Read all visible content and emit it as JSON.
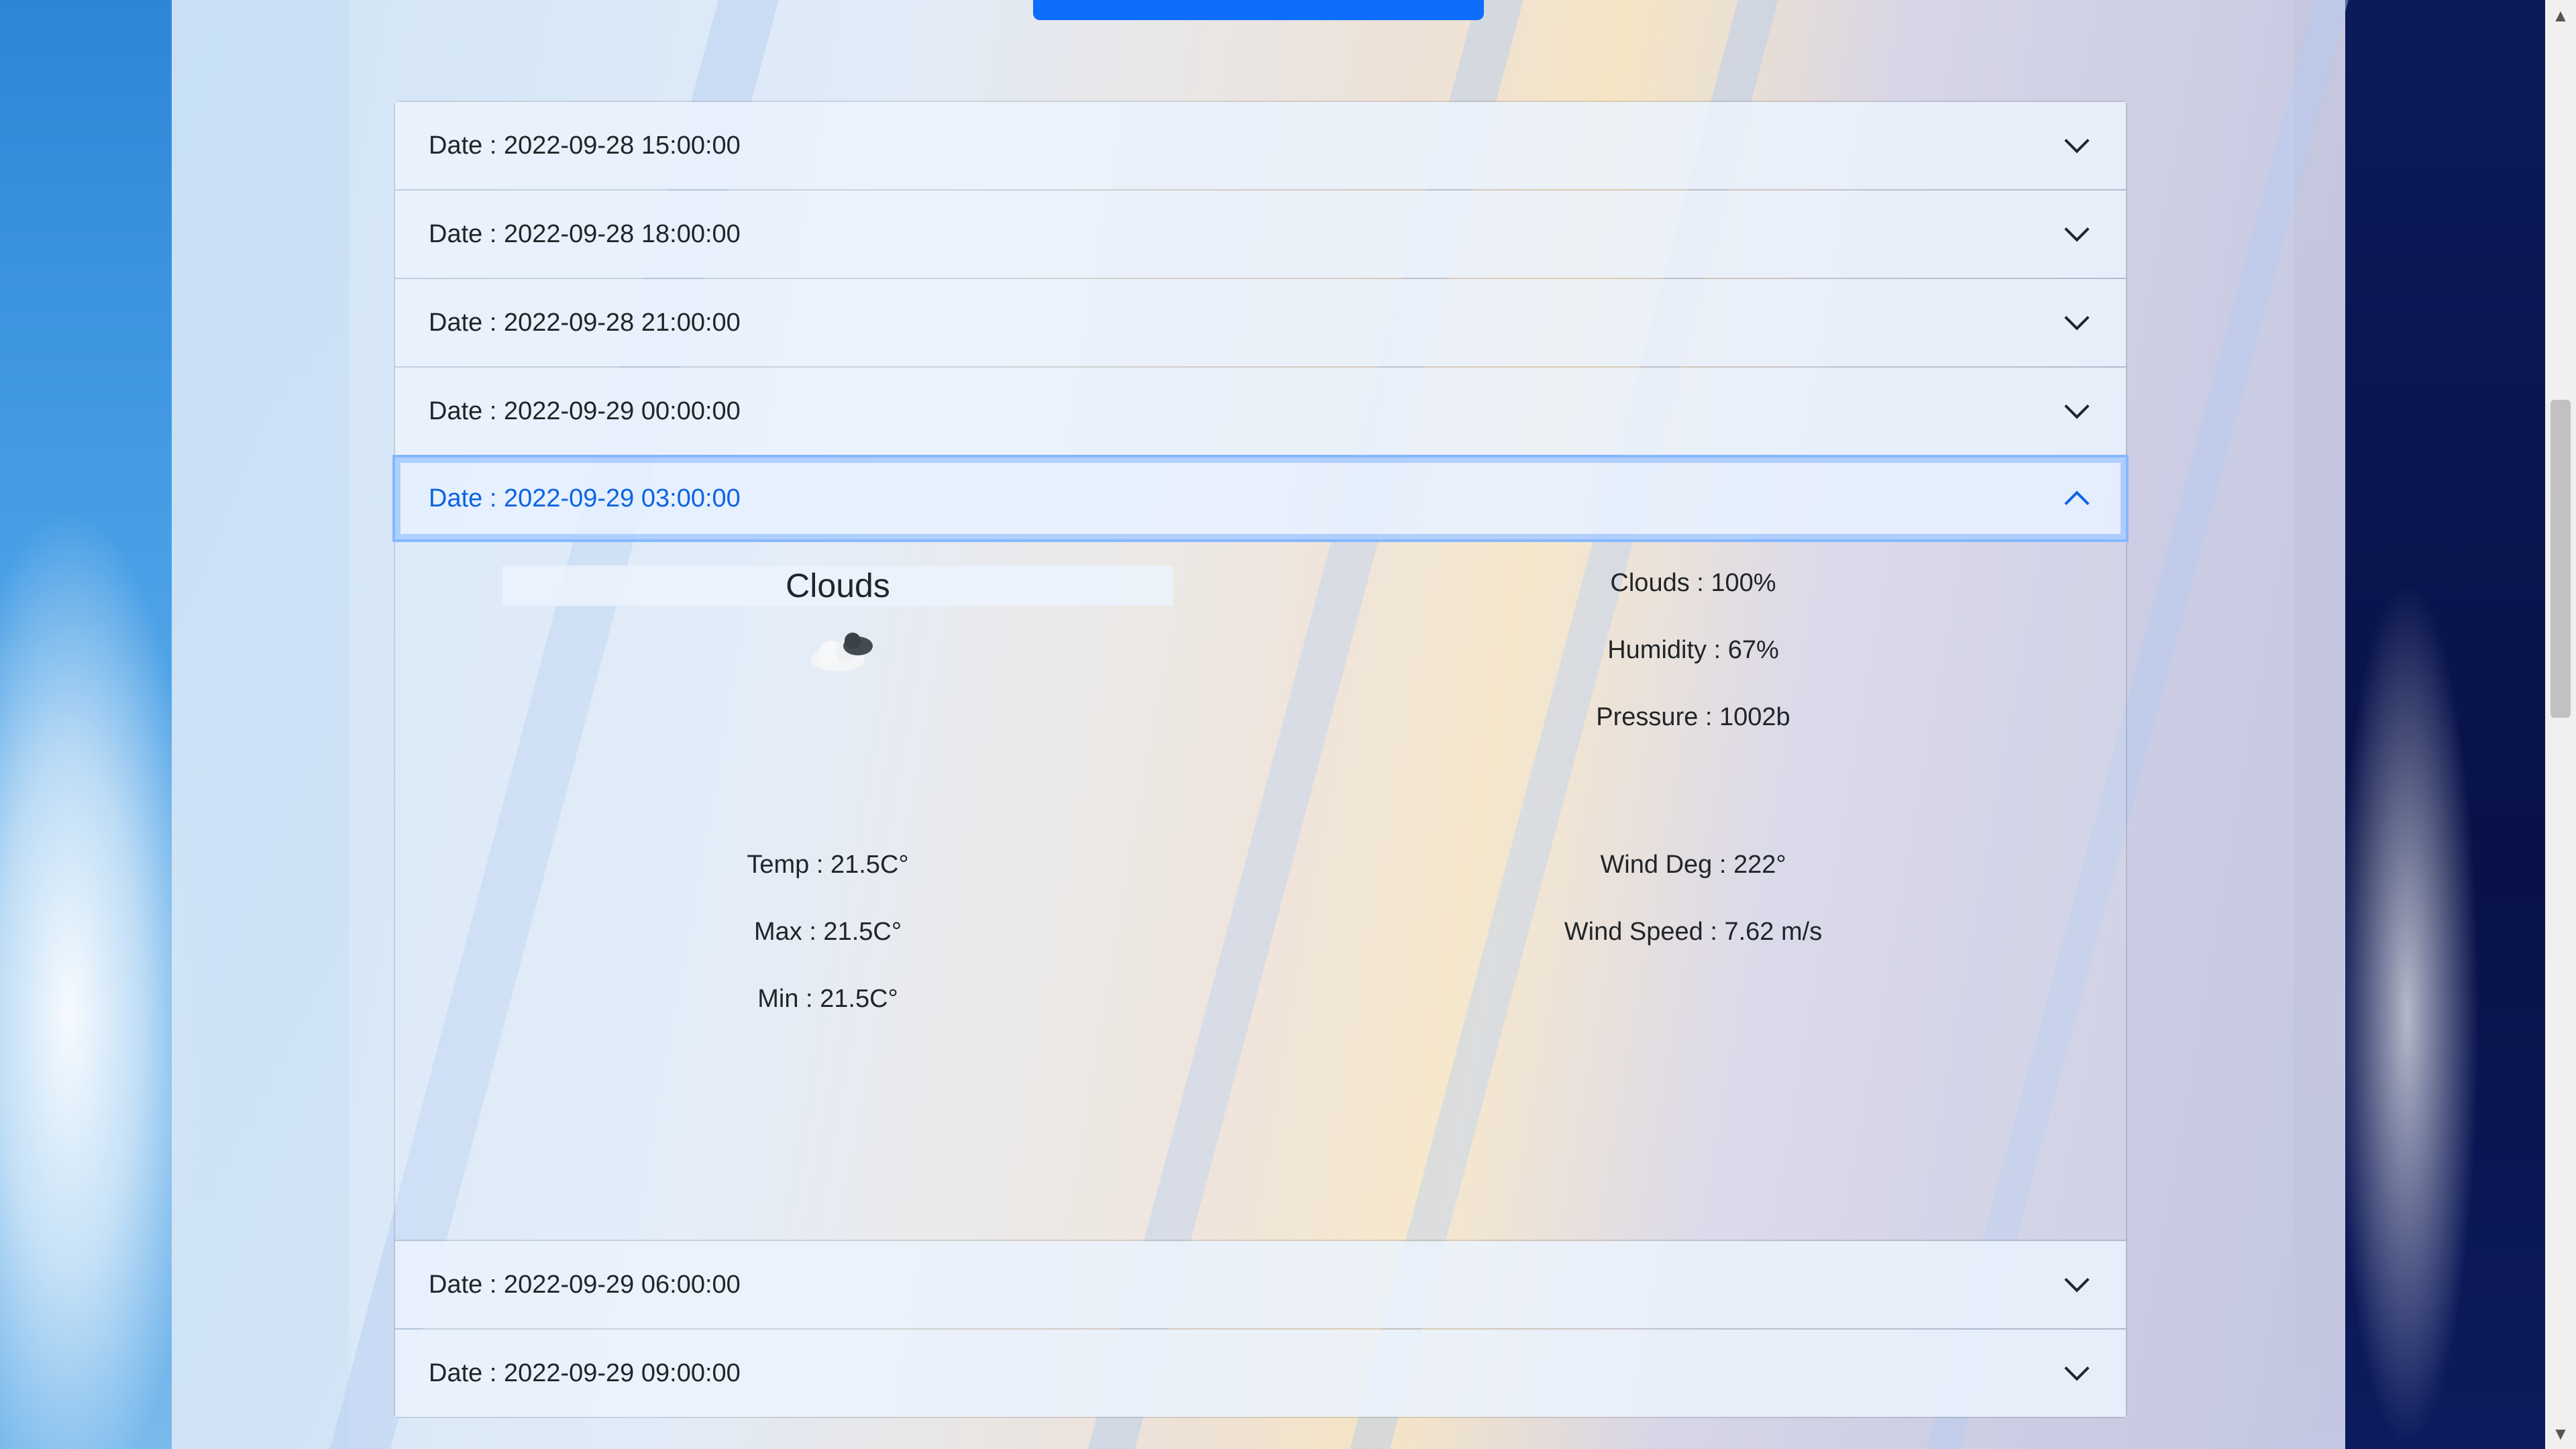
{
  "accordion": {
    "items": [
      {
        "label": "Date : 2022-09-28 15:00:00"
      },
      {
        "label": "Date : 2022-09-28 18:00:00"
      },
      {
        "label": "Date : 2022-09-28 21:00:00"
      },
      {
        "label": "Date : 2022-09-29 00:00:00"
      },
      {
        "label": "Date : 2022-09-29 03:00:00"
      },
      {
        "label": "Date : 2022-09-29 06:00:00"
      },
      {
        "label": "Date : 2022-09-29 09:00:00"
      }
    ]
  },
  "details": {
    "main": "Clouds",
    "icon": "cloud-icon",
    "temp": "Temp : 21.5C°",
    "max": "Max : 21.5C°",
    "min": "Min : 21.5C°",
    "clouds": "Clouds : 100%",
    "humidity": "Humidity : 67%",
    "pressure": "Pressure : 1002b",
    "wind_deg": "Wind Deg : 222°",
    "wind_speed": "Wind Speed : 7.62 m/s"
  },
  "colors": {
    "accent": "#0d6efd",
    "open_header_text": "#0c63e4"
  }
}
